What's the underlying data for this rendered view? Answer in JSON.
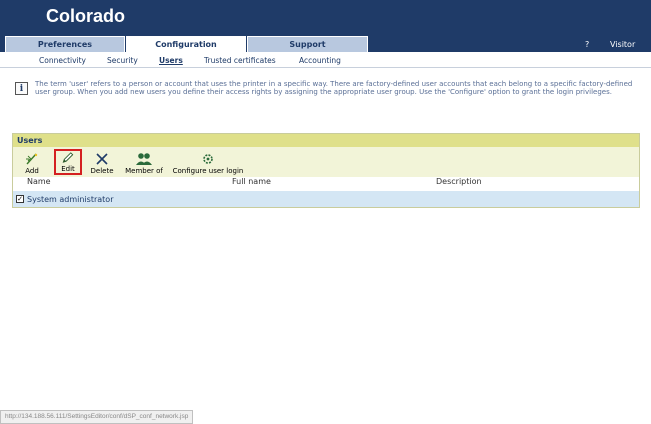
{
  "header": {
    "title": "Colorado",
    "tabs": [
      {
        "label": "Preferences",
        "active": false
      },
      {
        "label": "Configuration",
        "active": true
      },
      {
        "label": "Support",
        "active": false
      }
    ],
    "help": "?",
    "user": "Visitor"
  },
  "subnav": {
    "items": [
      "Connectivity",
      "Security",
      "Users",
      "Trusted certificates",
      "Accounting"
    ],
    "active": "Users"
  },
  "info": {
    "text": "The term 'user' refers to a person or account that uses the printer in a specific way. There are factory-defined user accounts that each belong to a specific factory-defined user group. When you add new users you define their access rights by assigning the appropriate user group. Use the 'Configure' option to grant the login privileges."
  },
  "users_panel": {
    "title": "Users",
    "toolbar": [
      {
        "label": "Add",
        "icon": "add-user-icon"
      },
      {
        "label": "Edit",
        "icon": "pencil-icon"
      },
      {
        "label": "Delete",
        "icon": "x-delete-icon"
      },
      {
        "label": "Member of",
        "icon": "group-members-icon"
      },
      {
        "label": "Configure user login",
        "icon": "login-config-icon"
      }
    ],
    "columns": [
      "Name",
      "Full name",
      "Description"
    ],
    "rows": [
      {
        "name": "System administrator",
        "full_name": "",
        "description": "",
        "checked": true
      }
    ]
  },
  "status_bar": {
    "url": "http://134.188.56.111/SettingsEditor/conf/dSP_conf_network.jsp"
  },
  "colors": {
    "header_bg": "#1f3b68",
    "panel_title_bg": "#dfe08a",
    "toolbar_bg": "#f2f4d8",
    "selected_row_bg": "#d4e6f4",
    "highlight_border": "#d42020"
  }
}
